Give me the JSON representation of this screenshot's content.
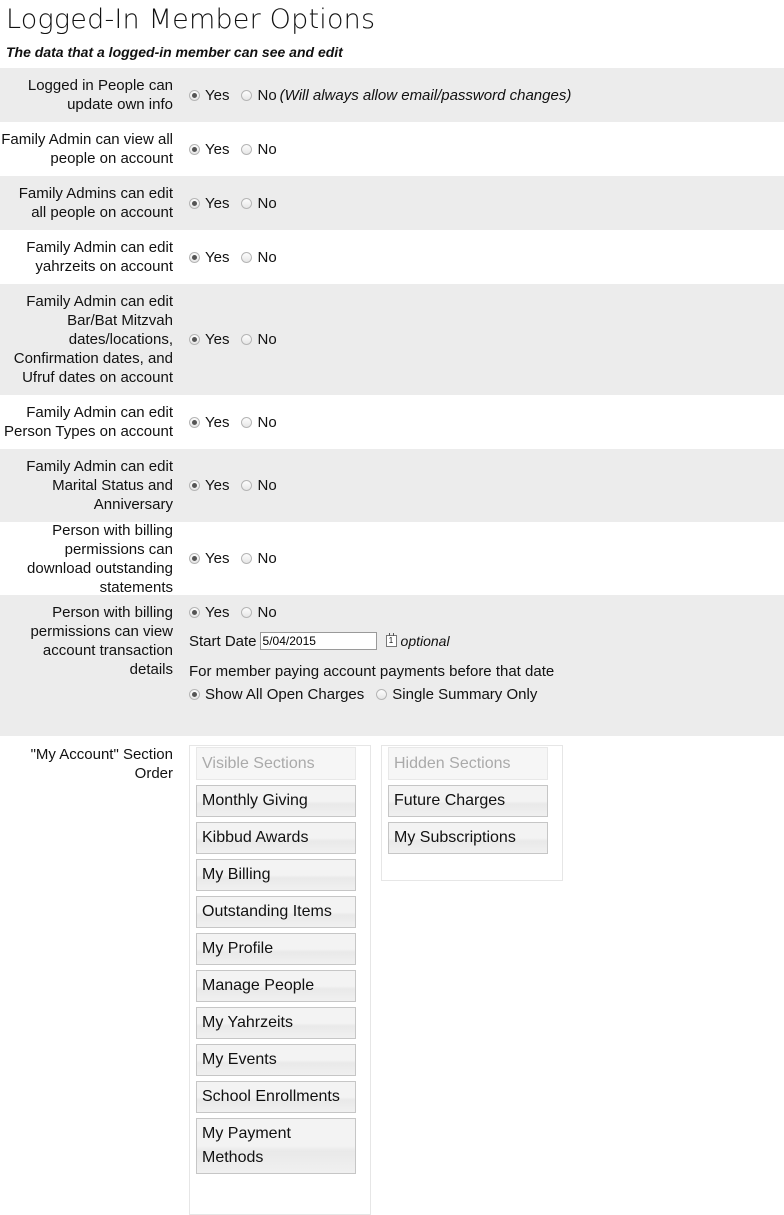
{
  "header": {
    "title": "Logged-In Member Options",
    "subtitle": "The data that a logged-in member can see and edit"
  },
  "options": [
    {
      "label": "Logged in People can update own info",
      "yes": "Yes",
      "no": "No",
      "note": "(Will always allow email/password changes)",
      "selected": "Yes"
    },
    {
      "label": "Family Admin can view all people on account",
      "yes": "Yes",
      "no": "No",
      "selected": "Yes"
    },
    {
      "label": "Family Admins can edit all people on account",
      "yes": "Yes",
      "no": "No",
      "selected": "Yes"
    },
    {
      "label": "Family Admin can edit yahrzeits on account",
      "yes": "Yes",
      "no": "No",
      "selected": "Yes"
    },
    {
      "label": "Family Admin can edit Bar/Bat Mitzvah dates/locations, Confirmation dates, and Ufruf dates on account",
      "yes": "Yes",
      "no": "No",
      "selected": "Yes"
    },
    {
      "label": "Family Admin can edit Person Types on account",
      "yes": "Yes",
      "no": "No",
      "selected": "Yes"
    },
    {
      "label": "Family Admin can edit Marital Status and Anniversary",
      "yes": "Yes",
      "no": "No",
      "selected": "Yes"
    },
    {
      "label": "Person with billing permissions can download outstanding statements",
      "yes": "Yes",
      "no": "No",
      "selected": "Yes"
    }
  ],
  "billing": {
    "label": "Person with billing permissions can view account transaction details",
    "yes": "Yes",
    "no": "No",
    "selected": "Yes",
    "start_date_label": "Start Date",
    "start_date_value": "5/04/2015",
    "calendar_icon": "calendar-icon",
    "optional_label": "optional",
    "payments_text": "For member paying account payments before that date",
    "show_all": "Show All Open Charges",
    "single_summary": "Single Summary Only",
    "payments_selected": "Show All Open Charges"
  },
  "section_order": {
    "label": "\"My Account\" Section Order",
    "visible_header": "Visible Sections",
    "hidden_header": "Hidden Sections",
    "visible": [
      "Monthly Giving",
      "Kibbud Awards",
      "My Billing",
      "Outstanding Items",
      "My Profile",
      "Manage People",
      "My Yahrzeits",
      "My Events",
      "School Enrollments",
      "My Payment Methods"
    ],
    "hidden": [
      "Future Charges",
      "My Subscriptions"
    ]
  }
}
